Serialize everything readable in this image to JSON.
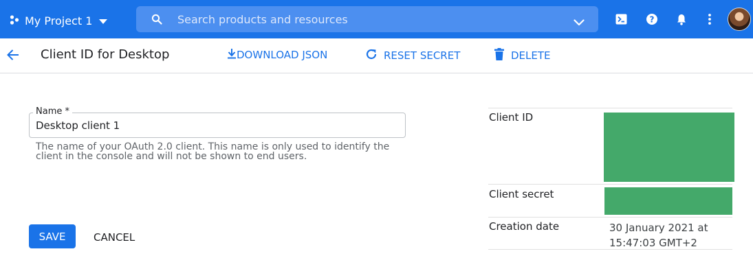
{
  "topbar": {
    "project_name": "My Project 1",
    "icons": {
      "project": "project-dots-icon",
      "dropdown": "caret-down-icon",
      "search": "search-icon",
      "search_expand": "chevron-down-icon",
      "terminal": "cloud-shell-icon",
      "help": "help-icon",
      "notifications": "bell-icon",
      "more": "more-vert-icon",
      "avatar": "user-avatar"
    },
    "color": "#1a73e8"
  },
  "search": {
    "placeholder": "Search products and resources"
  },
  "actionbar": {
    "title": "Client ID for Desktop",
    "download_json": "DOWNLOAD JSON",
    "reset_secret": "RESET SECRET",
    "delete": "DELETE",
    "icons": {
      "back": "arrow-back-icon",
      "download": "download-icon",
      "reset": "refresh-icon",
      "delete": "trash-icon"
    },
    "accent_color": "#1a73e8"
  },
  "form": {
    "name_label": "Name *",
    "name_value": "Desktop client 1",
    "help_text": "The name of your OAuth 2.0 client. This name is only used to identify the client in the console and will not be shown to end users.",
    "save_label": "SAVE",
    "cancel_label": "CANCEL"
  },
  "info": {
    "client_id_label": "Client ID",
    "client_secret_label": "Client secret",
    "creation_date_label": "Creation date",
    "creation_date_value": "30 January 2021 at 15:47:03 GMT+2",
    "redaction_color": "#44a96a"
  }
}
